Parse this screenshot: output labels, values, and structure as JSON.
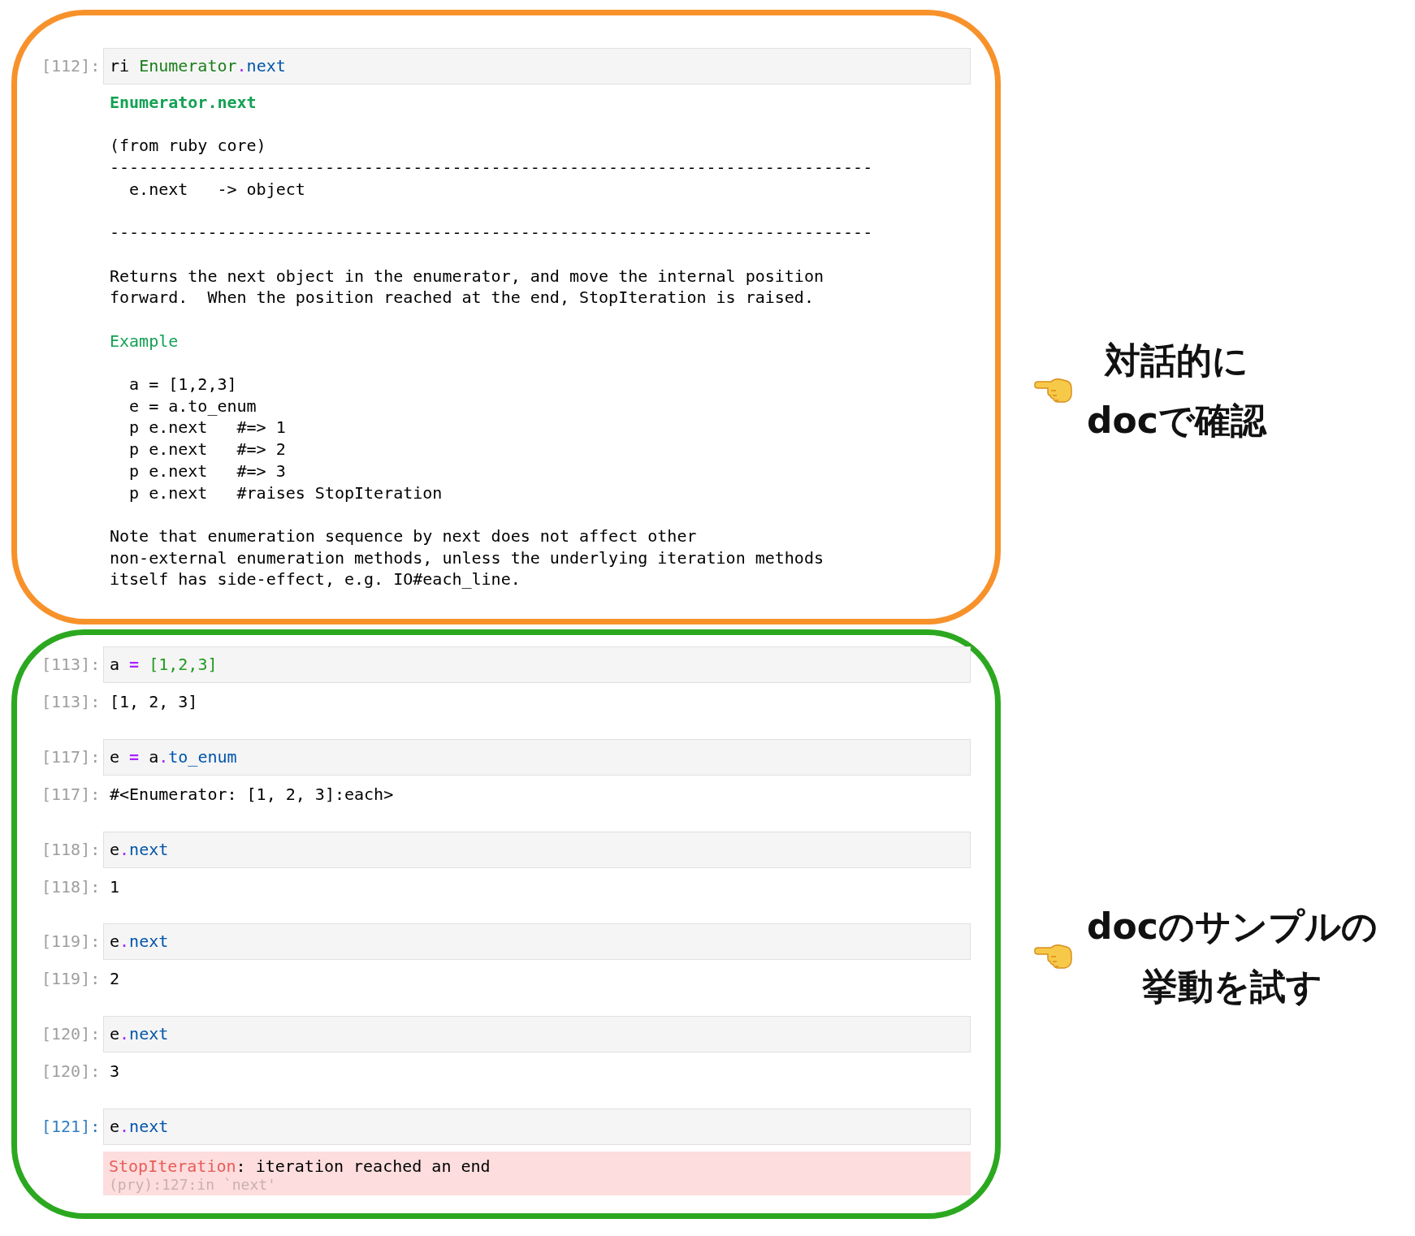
{
  "sections": [
    {
      "color": "#f7922b",
      "cells": [
        {
          "kind": "input",
          "prompt": "[112]:",
          "active": false,
          "tokens": [
            {
              "kind": "plain",
              "text": "ri "
            },
            {
              "kind": "class",
              "text": "Enumerator"
            },
            {
              "kind": "dot",
              "text": "."
            },
            {
              "kind": "method",
              "text": "next"
            }
          ]
        },
        {
          "kind": "doc",
          "blocks": [
            {
              "kind": "heading",
              "text": "Enumerator.next"
            },
            {
              "kind": "plain",
              "text": "(from ruby core)\n------------------------------------------------------------------------------\n  e.next   -> object"
            },
            {
              "kind": "plain",
              "text": "------------------------------------------------------------------------------\n\nReturns the next object in the enumerator, and move the internal position\nforward.  When the position reached at the end, StopIteration is raised."
            },
            {
              "kind": "section",
              "text": "Example"
            },
            {
              "kind": "plain",
              "text": "  a = [1,2,3]\n  e = a.to_enum\n  p e.next   #=> 1\n  p e.next   #=> 2\n  p e.next   #=> 3\n  p e.next   #raises StopIteration"
            },
            {
              "kind": "plain",
              "text": "Note that enumeration sequence by next does not affect other\nnon-external enumeration methods, unless the underlying iteration methods\nitself has side-effect, e.g. IO#each_line."
            }
          ]
        }
      ],
      "note": {
        "lines": [
          "対話的に",
          "docで確認"
        ]
      }
    },
    {
      "color": "#2ca820",
      "cells": [
        {
          "kind": "input",
          "prompt": "[113]:",
          "active": false,
          "tokens": [
            {
              "kind": "plain",
              "text": "a "
            },
            {
              "kind": "operator",
              "text": "="
            },
            {
              "kind": "literal",
              "text": " [1,2,3]"
            }
          ]
        },
        {
          "kind": "output",
          "prompt": "[113]:",
          "active": false,
          "text": "[1, 2, 3]"
        },
        {
          "kind": "input",
          "prompt": "[117]:",
          "active": false,
          "tokens": [
            {
              "kind": "plain",
              "text": "e "
            },
            {
              "kind": "operator",
              "text": "="
            },
            {
              "kind": "plain",
              "text": " a"
            },
            {
              "kind": "dot",
              "text": "."
            },
            {
              "kind": "method",
              "text": "to_enum"
            }
          ]
        },
        {
          "kind": "output",
          "prompt": "[117]:",
          "active": false,
          "text": "#<Enumerator: [1, 2, 3]:each>"
        },
        {
          "kind": "input",
          "prompt": "[118]:",
          "active": false,
          "tokens": [
            {
              "kind": "plain",
              "text": "e"
            },
            {
              "kind": "dot",
              "text": "."
            },
            {
              "kind": "method",
              "text": "next"
            }
          ]
        },
        {
          "kind": "output",
          "prompt": "[118]:",
          "active": false,
          "text": "1"
        },
        {
          "kind": "input",
          "prompt": "[119]:",
          "active": false,
          "tokens": [
            {
              "kind": "plain",
              "text": "e"
            },
            {
              "kind": "dot",
              "text": "."
            },
            {
              "kind": "method",
              "text": "next"
            }
          ]
        },
        {
          "kind": "output",
          "prompt": "[119]:",
          "active": false,
          "text": "2"
        },
        {
          "kind": "input",
          "prompt": "[120]:",
          "active": false,
          "tokens": [
            {
              "kind": "plain",
              "text": "e"
            },
            {
              "kind": "dot",
              "text": "."
            },
            {
              "kind": "method",
              "text": "next"
            }
          ]
        },
        {
          "kind": "output",
          "prompt": "[120]:",
          "active": false,
          "text": "3"
        },
        {
          "kind": "input",
          "prompt": "[121]:",
          "active": true,
          "tokens": [
            {
              "kind": "plain",
              "text": "e"
            },
            {
              "kind": "dot",
              "text": "."
            },
            {
              "kind": "method",
              "text": "next"
            }
          ]
        },
        {
          "kind": "error",
          "error_name": "StopIteration",
          "message": ": iteration reached an end",
          "traceback": "(pry):127:in `next'"
        }
      ],
      "note": {
        "lines": [
          "docのサンプルの",
          "挙動を試す"
        ]
      }
    }
  ]
}
